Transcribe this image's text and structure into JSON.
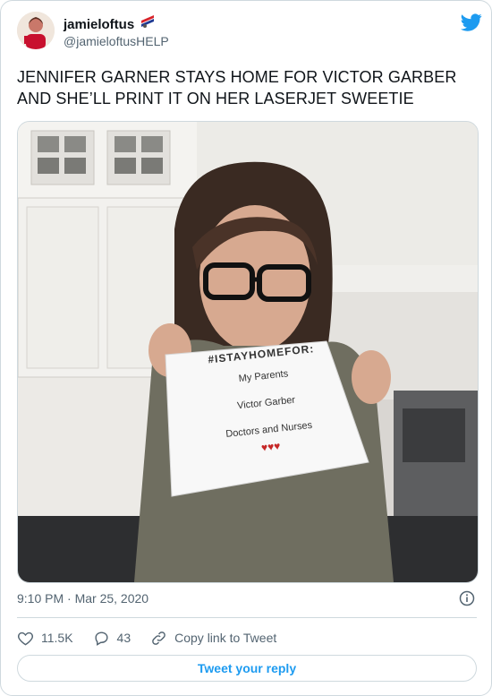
{
  "author": {
    "name": "jamieloftus",
    "handle": "@jamieloftusHELP"
  },
  "tweet": {
    "text_line1": "JENNIFER GARNER STAYS HOME FOR VICTOR GARBER",
    "text_line2": "AND SHE’LL PRINT IT ON HER LASERJET SWEETIE"
  },
  "media": {
    "sign": {
      "hashtag": "#ISTAYHOMEFOR:",
      "line1": "My Parents",
      "line2": "Victor Garber",
      "line3": "Doctors and Nurses",
      "hearts": "♥♥♥"
    }
  },
  "meta": {
    "timestamp": "9:10 PM · Mar 25, 2020"
  },
  "actions": {
    "likes": "11.5K",
    "replies": "43",
    "copy_link": "Copy link to Tweet"
  },
  "reply_button": "Tweet your reply",
  "colors": {
    "accent": "#1d9bf0",
    "heart_red": "#f91880",
    "muted": "#536471"
  },
  "icons": [
    "twitter-bird-icon",
    "info-icon",
    "heart-icon",
    "reply-icon",
    "link-icon",
    "verified-emoji-icon"
  ]
}
